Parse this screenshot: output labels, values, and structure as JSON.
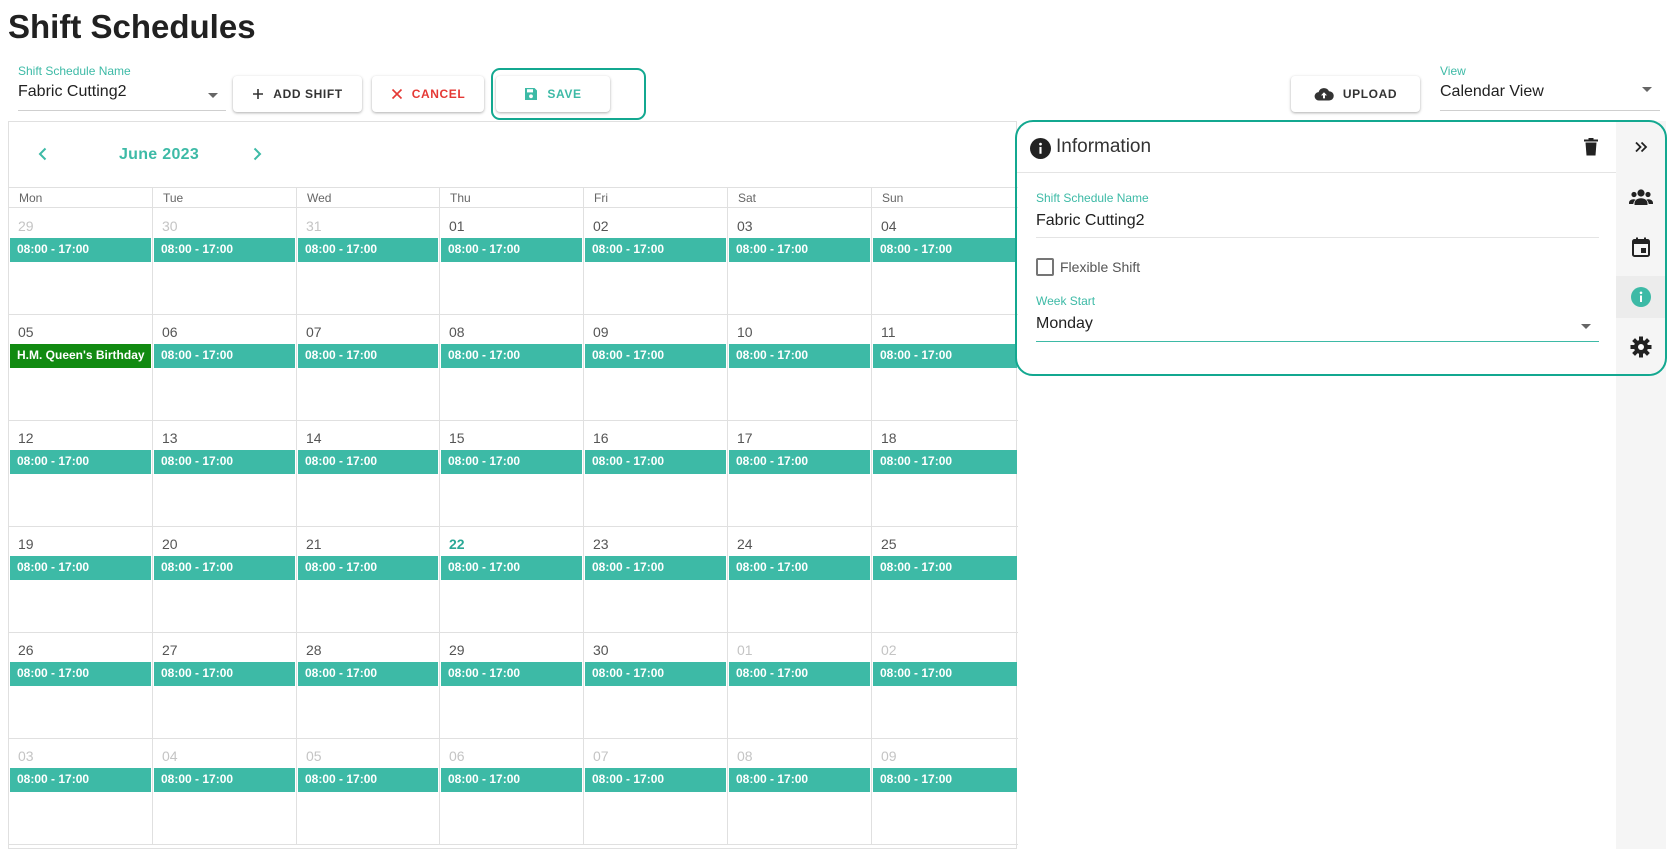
{
  "page_title": "Shift Schedules",
  "toolbar": {
    "schedule_name_label": "Shift Schedule Name",
    "schedule_name_value": "Fabric Cutting2",
    "add_shift": "ADD SHIFT",
    "cancel": "CANCEL",
    "save": "SAVE",
    "upload": "UPLOAD",
    "view_label": "View",
    "view_value": "Calendar View"
  },
  "calendar": {
    "month": "June 2023",
    "weekdays": [
      "Mon",
      "Tue",
      "Wed",
      "Thu",
      "Fri",
      "Sat",
      "Sun"
    ],
    "weeks": [
      [
        {
          "d": "29",
          "o": true,
          "e": "08:00 - 17:00"
        },
        {
          "d": "30",
          "o": true,
          "e": "08:00 - 17:00"
        },
        {
          "d": "31",
          "o": true,
          "e": "08:00 - 17:00"
        },
        {
          "d": "01",
          "e": "08:00 - 17:00"
        },
        {
          "d": "02",
          "e": "08:00 - 17:00"
        },
        {
          "d": "03",
          "e": "08:00 - 17:00"
        },
        {
          "d": "04",
          "e": "08:00 - 17:00"
        }
      ],
      [
        {
          "d": "05",
          "e": "H.M. Queen's Birthday",
          "h": true
        },
        {
          "d": "06",
          "e": "08:00 - 17:00"
        },
        {
          "d": "07",
          "e": "08:00 - 17:00"
        },
        {
          "d": "08",
          "e": "08:00 - 17:00"
        },
        {
          "d": "09",
          "e": "08:00 - 17:00"
        },
        {
          "d": "10",
          "e": "08:00 - 17:00"
        },
        {
          "d": "11",
          "e": "08:00 - 17:00"
        }
      ],
      [
        {
          "d": "12",
          "e": "08:00 - 17:00"
        },
        {
          "d": "13",
          "e": "08:00 - 17:00"
        },
        {
          "d": "14",
          "e": "08:00 - 17:00"
        },
        {
          "d": "15",
          "e": "08:00 - 17:00"
        },
        {
          "d": "16",
          "e": "08:00 - 17:00"
        },
        {
          "d": "17",
          "e": "08:00 - 17:00"
        },
        {
          "d": "18",
          "e": "08:00 - 17:00"
        }
      ],
      [
        {
          "d": "19",
          "e": "08:00 - 17:00"
        },
        {
          "d": "20",
          "e": "08:00 - 17:00"
        },
        {
          "d": "21",
          "e": "08:00 - 17:00"
        },
        {
          "d": "22",
          "t": true,
          "e": "08:00 - 17:00"
        },
        {
          "d": "23",
          "e": "08:00 - 17:00"
        },
        {
          "d": "24",
          "e": "08:00 - 17:00"
        },
        {
          "d": "25",
          "e": "08:00 - 17:00"
        }
      ],
      [
        {
          "d": "26",
          "e": "08:00 - 17:00"
        },
        {
          "d": "27",
          "e": "08:00 - 17:00"
        },
        {
          "d": "28",
          "e": "08:00 - 17:00"
        },
        {
          "d": "29",
          "e": "08:00 - 17:00"
        },
        {
          "d": "30",
          "e": "08:00 - 17:00"
        },
        {
          "d": "01",
          "o": true,
          "e": "08:00 - 17:00"
        },
        {
          "d": "02",
          "o": true,
          "e": "08:00 - 17:00"
        }
      ],
      [
        {
          "d": "03",
          "o": true,
          "e": "08:00 - 17:00"
        },
        {
          "d": "04",
          "o": true,
          "e": "08:00 - 17:00"
        },
        {
          "d": "05",
          "o": true,
          "e": "08:00 - 17:00"
        },
        {
          "d": "06",
          "o": true,
          "e": "08:00 - 17:00"
        },
        {
          "d": "07",
          "o": true,
          "e": "08:00 - 17:00"
        },
        {
          "d": "08",
          "o": true,
          "e": "08:00 - 17:00"
        },
        {
          "d": "09",
          "o": true,
          "e": "08:00 - 17:00"
        }
      ]
    ]
  },
  "info_panel": {
    "title": "Information",
    "name_label": "Shift Schedule Name",
    "name_value": "Fabric Cutting2",
    "flexible_label": "Flexible Shift",
    "flexible_checked": false,
    "week_start_label": "Week Start",
    "week_start_value": "Monday"
  },
  "sidebar_icons": [
    "collapse-icon",
    "users-icon",
    "calendar-icon",
    "info-icon",
    "settings-icon"
  ],
  "colors": {
    "accent": "#3dbaa6",
    "highlight_ring": "#13a890",
    "holiday": "#118a11",
    "cancel": "#e53935"
  }
}
